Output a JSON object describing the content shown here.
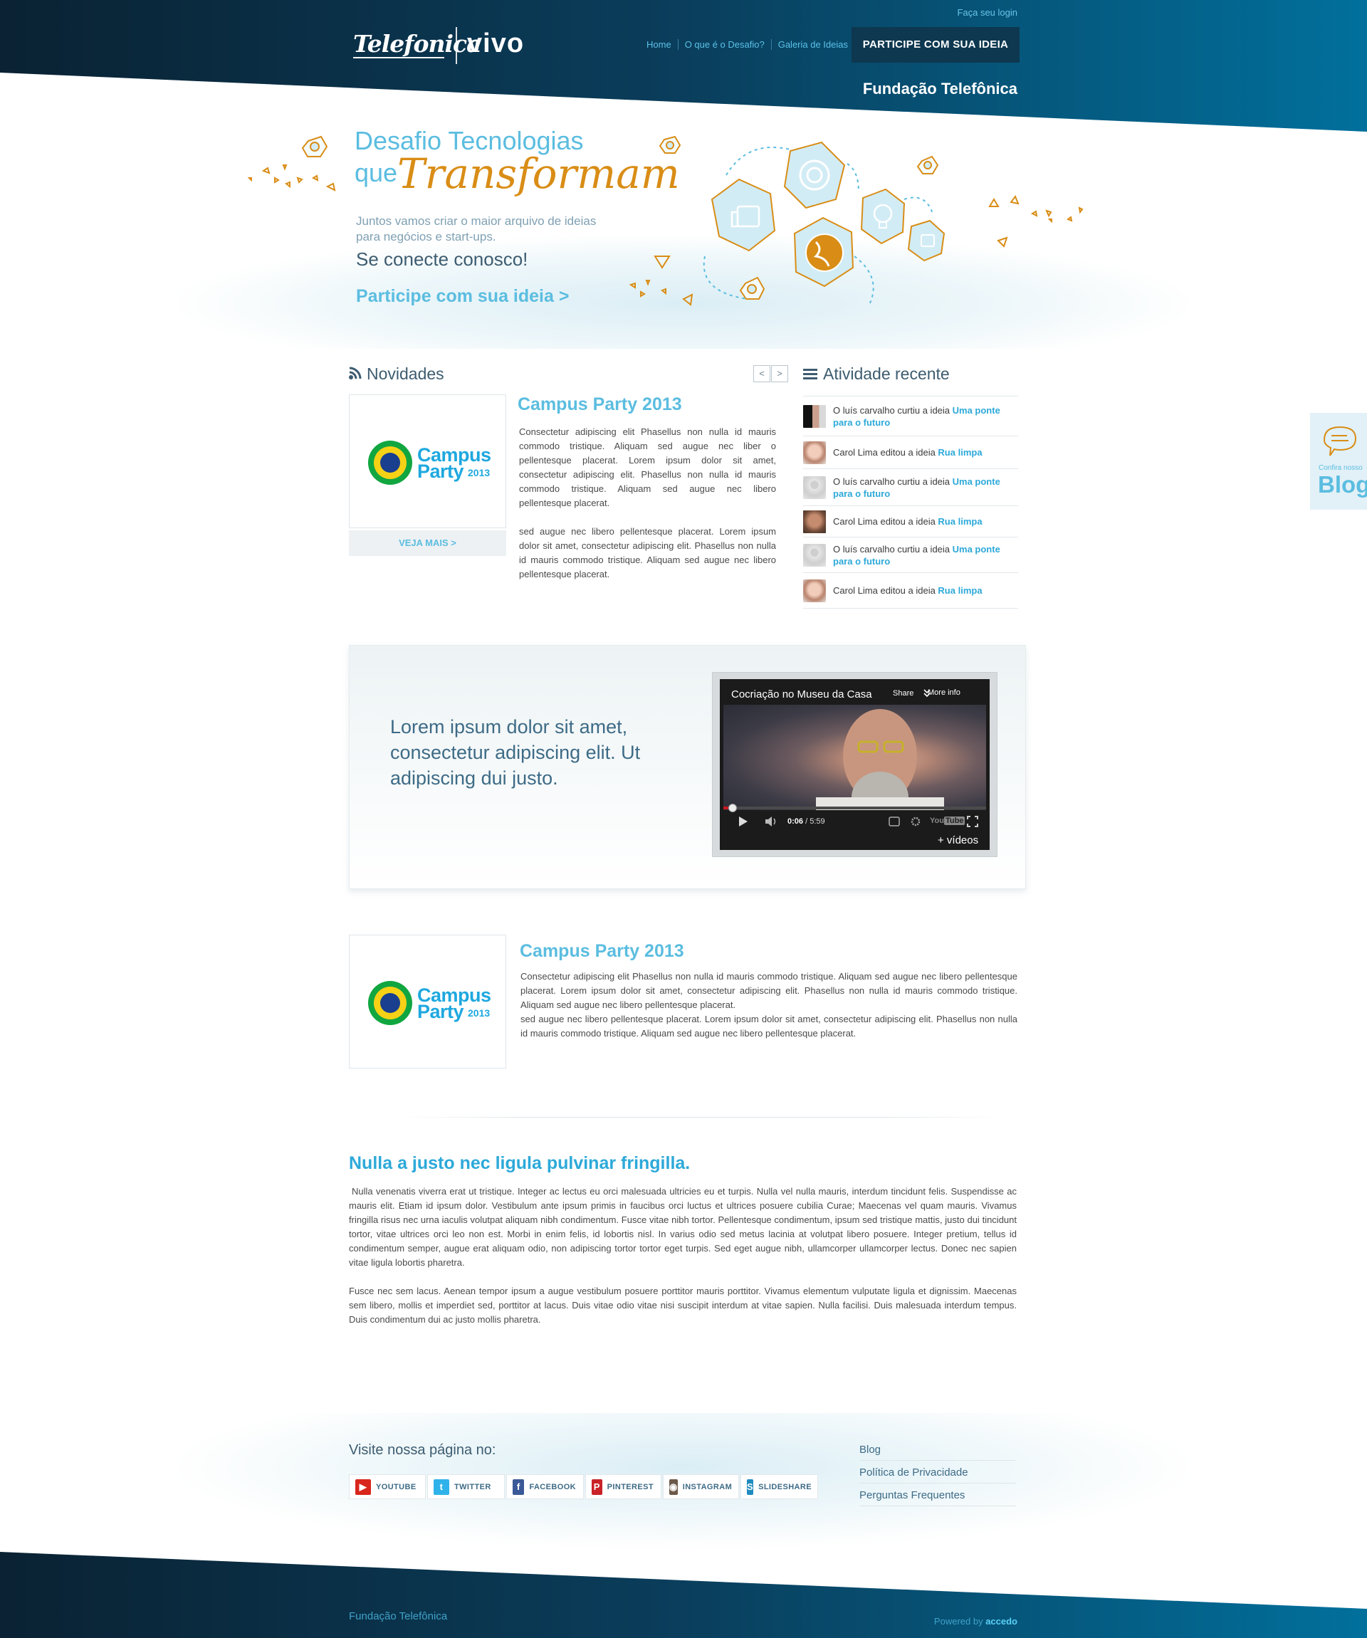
{
  "header": {
    "login_link": "Faça seu login",
    "logo_telefonica": "Telefonica",
    "logo_vivo": "vivo",
    "nav": [
      "Home",
      "O que é o Desafio?",
      "Galeria de Ideias"
    ],
    "cta": "PARTICIPE COM SUA IDEIA",
    "fundacao": "Fundação Telefônica"
  },
  "hero": {
    "title_line1": "Desafio Tecnologias",
    "title_line2_prefix": "que",
    "title_line2_script": "Transformam",
    "subtitle": "Juntos vamos criar o maior arquivo de ideias para negócios e start-ups.",
    "connect": "Se conecte conosco!",
    "link": "Participe com sua ideia >"
  },
  "news": {
    "heading": "Novidades",
    "prev": "<",
    "next": ">",
    "logo_line1": "Campus",
    "logo_line2": "Party",
    "logo_year": "2013",
    "veja_mais": "VEJA MAIS >",
    "title": "Campus Party 2013",
    "body_p1": "Consectetur adipiscing elit Phasellus non nulla id mauris commodo tristique. Aliquam sed augue nec liber o pellentesque placerat. Lorem ipsum dolor sit amet, consectetur adipiscing elit. Phasellus non nulla id mauris commodo tristique. Aliquam sed augue nec libero pellentesque placerat.",
    "body_p2": "sed augue nec libero pellentesque placerat. Lorem ipsum dolor sit amet, consectetur adipiscing elit. Phasellus non nulla id mauris commodo tristique. Aliquam sed augue nec libero pellentesque placerat."
  },
  "activity": {
    "heading": "Atividade recente",
    "items": [
      {
        "text": "O luís carvalho curtiu a ideia ",
        "link": "Uma ponte para o futuro"
      },
      {
        "text": "Carol Lima editou a ideia ",
        "link": "Rua limpa"
      },
      {
        "text": "O luís carvalho curtiu a ideia ",
        "link": "Uma ponte para o futuro"
      },
      {
        "text": "Carol Lima editou a ideia ",
        "link": "Rua limpa"
      },
      {
        "text": "O luís carvalho curtiu a ideia ",
        "link": "Uma ponte para o futuro"
      },
      {
        "text": "Carol Lima editou a ideia ",
        "link": "Rua limpa"
      }
    ]
  },
  "blog_tab": {
    "small": "Confira nosso",
    "big": "Blog"
  },
  "feature": {
    "text": "Lorem ipsum dolor sit amet, consectetur adipiscing elit. Ut adipiscing dui justo.",
    "video_title": "Cocriação no Museu da Casa",
    "video_share": "Share",
    "video_more": "More info",
    "video_time_current": "0:06",
    "video_time_total": " / 5:59",
    "video_progress": 0.02,
    "more_videos": "+ vídeos"
  },
  "news2": {
    "logo_line1": "Campus",
    "logo_line2": "Party",
    "logo_year": "2013",
    "title": "Campus Party 2013",
    "body_p1": "Consectetur adipiscing elit Phasellus non nulla id mauris commodo tristique. Aliquam sed augue nec libero pellentesque placerat. Lorem ipsum dolor sit amet, consectetur adipiscing elit. Phasellus non nulla id mauris commodo tristique. Aliquam sed augue nec libero pellentesque placerat.",
    "body_p2": "sed augue nec libero pellentesque placerat. Lorem ipsum dolor sit amet, consectetur adipiscing elit. Phasellus non nulla id mauris commodo tristique. Aliquam sed augue nec libero pellentesque placerat."
  },
  "article": {
    "title": "Nulla a justo nec ligula pulvinar fringilla.",
    "p1": "Nulla venenatis viverra erat ut tristique. Integer ac lectus eu orci malesuada ultricies eu et turpis. Nulla vel nulla mauris, interdum tincidunt felis. Suspendisse ac mauris elit. Etiam id ipsum dolor. Vestibulum ante ipsum primis in faucibus orci luctus et ultrices posuere cubilia Curae; Maecenas vel quam mauris. Vivamus fringilla risus nec urna iaculis volutpat aliquam nibh condimentum. Fusce vitae nibh tortor. Pellentesque condimentum, ipsum sed tristique mattis, justo dui tincidunt tortor, vitae ultrices orci leo non est. Morbi in enim felis, id lobortis nisl. In varius odio sed metus lacinia at volutpat libero posuere. Integer pretium, tellus id condimentum semper, augue erat aliquam odio, non adipiscing tortor tortor eget turpis. Sed eget augue nibh, ullamcorper ullamcorper lectus. Donec nec sapien vitae ligula lobortis pharetra.",
    "p2": "Fusce nec sem lacus. Aenean tempor ipsum a augue vestibulum posuere porttitor mauris porttitor. Vivamus elementum vulputate ligula et dignissim. Maecenas sem libero, mollis et imperdiet sed, porttitor at lacus. Duis vitae odio vitae nisi suscipit interdum at vitae sapien. Nulla facilisi. Duis malesuada interdum tempus. Duis condimentum dui ac justo mollis pharetra."
  },
  "footer": {
    "visit_title": "Visite nossa página no:",
    "social": [
      {
        "label": "YOUTUBE",
        "icon": "youtube-icon",
        "color": "#d8261c",
        "glyph": "▶"
      },
      {
        "label": "TWITTER",
        "icon": "twitter-icon",
        "color": "#2fb2ea",
        "glyph": "t"
      },
      {
        "label": "FACEBOOK",
        "icon": "facebook-icon",
        "color": "#3b5998",
        "glyph": "f"
      },
      {
        "label": "PINTEREST",
        "icon": "pinterest-icon",
        "color": "#c92228",
        "glyph": "P"
      },
      {
        "label": "INSTAGRAM",
        "icon": "instagram-icon",
        "color": "#6d5a4a",
        "glyph": "◉"
      },
      {
        "label": "SLIDESHARE",
        "icon": "slideshare-icon",
        "color": "#1f8bbf",
        "glyph": "S"
      }
    ],
    "links": [
      "Blog",
      "Política de Privacidade",
      "Perguntas Frequentes"
    ],
    "fundacao": "Fundação Telefônica",
    "powered_by": "Powered by ",
    "powered_brand": "accedo"
  },
  "colors": {
    "dark_navy": "#0b2537",
    "deep_blue": "#01678f",
    "accent": "#5bbde0",
    "orange": "#d98d16"
  }
}
